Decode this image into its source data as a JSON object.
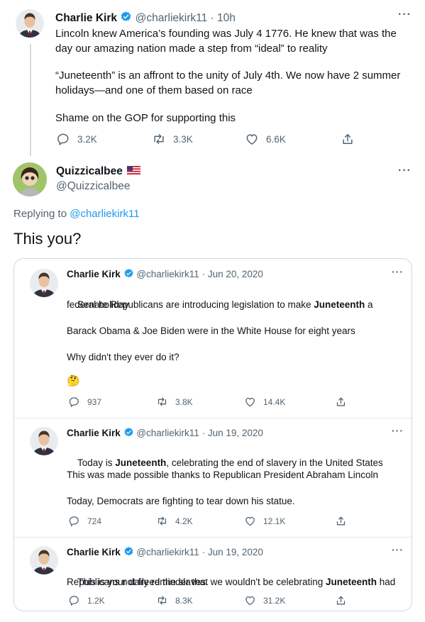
{
  "main_tweet": {
    "author_name": "Charlie Kirk",
    "handle": "@charliekirk11",
    "separator": "·",
    "time": "10h",
    "paragraphs": [
      "Lincoln knew America’s founding was July 4 1776. He knew that was the day our amazing nation made a step from “ideal” to reality",
      "“Juneteenth” is an affront to the unity of July 4th. We now have 2 summer holidays—and one of them based on race",
      "Shame on the GOP for supporting this"
    ],
    "replies": "3.2K",
    "retweets": "3.3K",
    "likes": "6.6K"
  },
  "reply_tweet": {
    "author_name": "Quizzicalbee",
    "flag_icon": "us-flag-icon",
    "handle": "@Quizzicalbee",
    "replying_prefix": "Replying to ",
    "replying_to": "@charliekirk11",
    "text": "This you?"
  },
  "quoted_tweets": [
    {
      "author_name": "Charlie Kirk",
      "handle": "@charliekirk11",
      "separator": "·",
      "date": "Jun 20, 2020",
      "line1_before": "Senate Republicans are introducing legislation to make ",
      "line1_bold": "Juneteenth",
      "line1_after": " a",
      "line2": "federal holiday",
      "para2": "Barack Obama & Joe Biden were in the White House for eight years",
      "para3": "Why didn't they ever do it?",
      "emoji": "🤔",
      "replies": "937",
      "retweets": "3.8K",
      "likes": "14.4K"
    },
    {
      "author_name": "Charlie Kirk",
      "handle": "@charliekirk11",
      "separator": "·",
      "date": "Jun 19, 2020",
      "line1_before": "Today is ",
      "line1_bold": "Juneteenth",
      "line1_after": ", celebrating the end of slavery in the United States",
      "para2": "This was made possible thanks to Republican President Abraham Lincoln",
      "para3": "Today, Democrats are fighting to tear down his statue.",
      "replies": "724",
      "retweets": "4.2K",
      "likes": "12.1K"
    },
    {
      "author_name": "Charlie Kirk",
      "handle": "@charliekirk11",
      "separator": "·",
      "date": "Jun 19, 2020",
      "line1_before": "This is your daily reminder that we wouldn't be celebrating ",
      "line1_bold": "Juneteenth",
      "line1_after": " had",
      "line2": "Republicans not freed the slaves.",
      "replies": "1.2K",
      "retweets": "8.3K",
      "likes": "31.2K"
    }
  ],
  "colors": {
    "link": "#1d9bf0",
    "muted": "#536471",
    "verified": "#1d9bf0"
  }
}
